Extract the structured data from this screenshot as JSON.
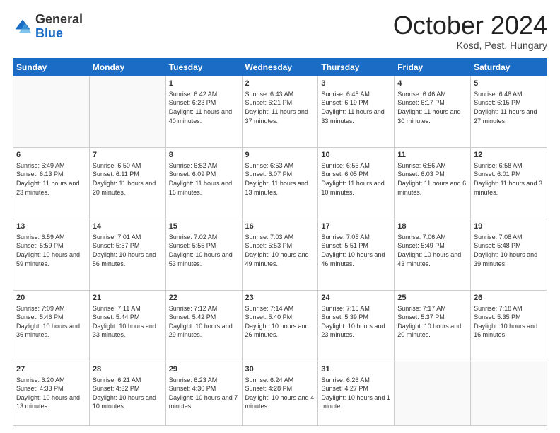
{
  "header": {
    "logo_general": "General",
    "logo_blue": "Blue",
    "month": "October 2024",
    "location": "Kosd, Pest, Hungary"
  },
  "weekdays": [
    "Sunday",
    "Monday",
    "Tuesday",
    "Wednesday",
    "Thursday",
    "Friday",
    "Saturday"
  ],
  "weeks": [
    [
      {
        "day": "",
        "sunrise": "",
        "sunset": "",
        "daylight": ""
      },
      {
        "day": "",
        "sunrise": "",
        "sunset": "",
        "daylight": ""
      },
      {
        "day": "1",
        "sunrise": "Sunrise: 6:42 AM",
        "sunset": "Sunset: 6:23 PM",
        "daylight": "Daylight: 11 hours and 40 minutes."
      },
      {
        "day": "2",
        "sunrise": "Sunrise: 6:43 AM",
        "sunset": "Sunset: 6:21 PM",
        "daylight": "Daylight: 11 hours and 37 minutes."
      },
      {
        "day": "3",
        "sunrise": "Sunrise: 6:45 AM",
        "sunset": "Sunset: 6:19 PM",
        "daylight": "Daylight: 11 hours and 33 minutes."
      },
      {
        "day": "4",
        "sunrise": "Sunrise: 6:46 AM",
        "sunset": "Sunset: 6:17 PM",
        "daylight": "Daylight: 11 hours and 30 minutes."
      },
      {
        "day": "5",
        "sunrise": "Sunrise: 6:48 AM",
        "sunset": "Sunset: 6:15 PM",
        "daylight": "Daylight: 11 hours and 27 minutes."
      }
    ],
    [
      {
        "day": "6",
        "sunrise": "Sunrise: 6:49 AM",
        "sunset": "Sunset: 6:13 PM",
        "daylight": "Daylight: 11 hours and 23 minutes."
      },
      {
        "day": "7",
        "sunrise": "Sunrise: 6:50 AM",
        "sunset": "Sunset: 6:11 PM",
        "daylight": "Daylight: 11 hours and 20 minutes."
      },
      {
        "day": "8",
        "sunrise": "Sunrise: 6:52 AM",
        "sunset": "Sunset: 6:09 PM",
        "daylight": "Daylight: 11 hours and 16 minutes."
      },
      {
        "day": "9",
        "sunrise": "Sunrise: 6:53 AM",
        "sunset": "Sunset: 6:07 PM",
        "daylight": "Daylight: 11 hours and 13 minutes."
      },
      {
        "day": "10",
        "sunrise": "Sunrise: 6:55 AM",
        "sunset": "Sunset: 6:05 PM",
        "daylight": "Daylight: 11 hours and 10 minutes."
      },
      {
        "day": "11",
        "sunrise": "Sunrise: 6:56 AM",
        "sunset": "Sunset: 6:03 PM",
        "daylight": "Daylight: 11 hours and 6 minutes."
      },
      {
        "day": "12",
        "sunrise": "Sunrise: 6:58 AM",
        "sunset": "Sunset: 6:01 PM",
        "daylight": "Daylight: 11 hours and 3 minutes."
      }
    ],
    [
      {
        "day": "13",
        "sunrise": "Sunrise: 6:59 AM",
        "sunset": "Sunset: 5:59 PM",
        "daylight": "Daylight: 10 hours and 59 minutes."
      },
      {
        "day": "14",
        "sunrise": "Sunrise: 7:01 AM",
        "sunset": "Sunset: 5:57 PM",
        "daylight": "Daylight: 10 hours and 56 minutes."
      },
      {
        "day": "15",
        "sunrise": "Sunrise: 7:02 AM",
        "sunset": "Sunset: 5:55 PM",
        "daylight": "Daylight: 10 hours and 53 minutes."
      },
      {
        "day": "16",
        "sunrise": "Sunrise: 7:03 AM",
        "sunset": "Sunset: 5:53 PM",
        "daylight": "Daylight: 10 hours and 49 minutes."
      },
      {
        "day": "17",
        "sunrise": "Sunrise: 7:05 AM",
        "sunset": "Sunset: 5:51 PM",
        "daylight": "Daylight: 10 hours and 46 minutes."
      },
      {
        "day": "18",
        "sunrise": "Sunrise: 7:06 AM",
        "sunset": "Sunset: 5:49 PM",
        "daylight": "Daylight: 10 hours and 43 minutes."
      },
      {
        "day": "19",
        "sunrise": "Sunrise: 7:08 AM",
        "sunset": "Sunset: 5:48 PM",
        "daylight": "Daylight: 10 hours and 39 minutes."
      }
    ],
    [
      {
        "day": "20",
        "sunrise": "Sunrise: 7:09 AM",
        "sunset": "Sunset: 5:46 PM",
        "daylight": "Daylight: 10 hours and 36 minutes."
      },
      {
        "day": "21",
        "sunrise": "Sunrise: 7:11 AM",
        "sunset": "Sunset: 5:44 PM",
        "daylight": "Daylight: 10 hours and 33 minutes."
      },
      {
        "day": "22",
        "sunrise": "Sunrise: 7:12 AM",
        "sunset": "Sunset: 5:42 PM",
        "daylight": "Daylight: 10 hours and 29 minutes."
      },
      {
        "day": "23",
        "sunrise": "Sunrise: 7:14 AM",
        "sunset": "Sunset: 5:40 PM",
        "daylight": "Daylight: 10 hours and 26 minutes."
      },
      {
        "day": "24",
        "sunrise": "Sunrise: 7:15 AM",
        "sunset": "Sunset: 5:39 PM",
        "daylight": "Daylight: 10 hours and 23 minutes."
      },
      {
        "day": "25",
        "sunrise": "Sunrise: 7:17 AM",
        "sunset": "Sunset: 5:37 PM",
        "daylight": "Daylight: 10 hours and 20 minutes."
      },
      {
        "day": "26",
        "sunrise": "Sunrise: 7:18 AM",
        "sunset": "Sunset: 5:35 PM",
        "daylight": "Daylight: 10 hours and 16 minutes."
      }
    ],
    [
      {
        "day": "27",
        "sunrise": "Sunrise: 6:20 AM",
        "sunset": "Sunset: 4:33 PM",
        "daylight": "Daylight: 10 hours and 13 minutes."
      },
      {
        "day": "28",
        "sunrise": "Sunrise: 6:21 AM",
        "sunset": "Sunset: 4:32 PM",
        "daylight": "Daylight: 10 hours and 10 minutes."
      },
      {
        "day": "29",
        "sunrise": "Sunrise: 6:23 AM",
        "sunset": "Sunset: 4:30 PM",
        "daylight": "Daylight: 10 hours and 7 minutes."
      },
      {
        "day": "30",
        "sunrise": "Sunrise: 6:24 AM",
        "sunset": "Sunset: 4:28 PM",
        "daylight": "Daylight: 10 hours and 4 minutes."
      },
      {
        "day": "31",
        "sunrise": "Sunrise: 6:26 AM",
        "sunset": "Sunset: 4:27 PM",
        "daylight": "Daylight: 10 hours and 1 minute."
      },
      {
        "day": "",
        "sunrise": "",
        "sunset": "",
        "daylight": ""
      },
      {
        "day": "",
        "sunrise": "",
        "sunset": "",
        "daylight": ""
      }
    ]
  ]
}
